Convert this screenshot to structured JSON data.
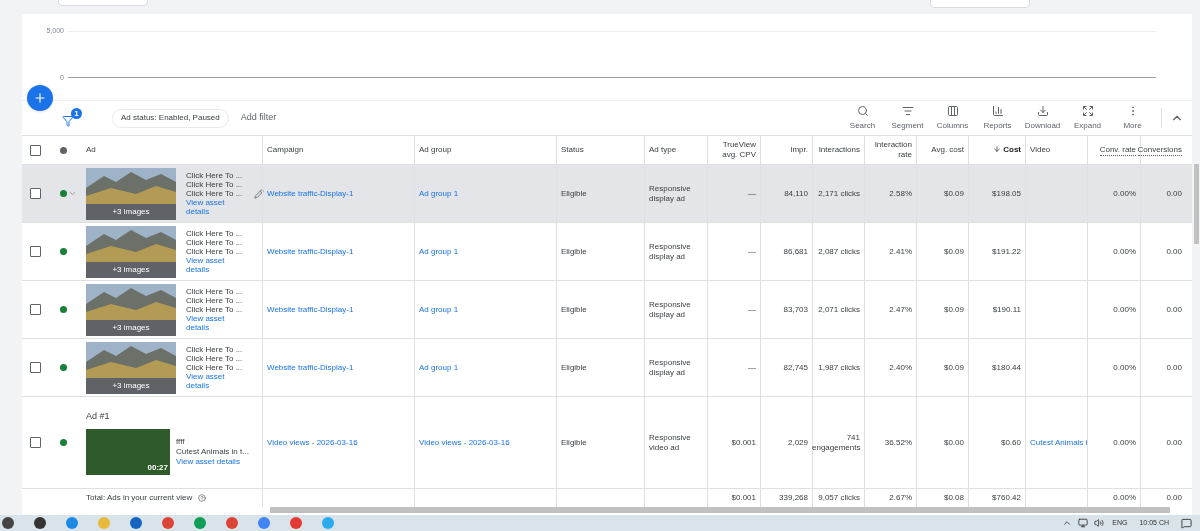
{
  "chart": {
    "yticks": [
      "5,000",
      "0"
    ]
  },
  "filter_bar": {
    "filter_count": "1",
    "chips": [
      "Ad status: Enabled, Paused"
    ],
    "add_filter": "Add filter"
  },
  "tools": [
    {
      "kind": "search",
      "label": "Search"
    },
    {
      "kind": "segment",
      "label": "Segment"
    },
    {
      "kind": "columns",
      "label": "Columns"
    },
    {
      "kind": "reports",
      "label": "Reports"
    },
    {
      "kind": "download",
      "label": "Download"
    },
    {
      "kind": "expand",
      "label": "Expand"
    },
    {
      "kind": "more",
      "label": "More"
    }
  ],
  "table": {
    "header_checked": false,
    "ad_column": "Ad",
    "columns": [
      {
        "label": "Campaign",
        "kind": "link",
        "sorted": false,
        "dotted": false
      },
      {
        "label": "Ad group",
        "kind": "link",
        "sorted": false,
        "dotted": false
      },
      {
        "label": "Status",
        "kind": "text",
        "sorted": false,
        "dotted": false
      },
      {
        "label": "Ad type",
        "kind": "text",
        "sorted": false,
        "dotted": false
      },
      {
        "label": "TrueView avg. CPV",
        "kind": "number",
        "sorted": false,
        "dotted": false
      },
      {
        "label": "Impr.",
        "kind": "number",
        "sorted": false,
        "dotted": false
      },
      {
        "label": "Interactions",
        "kind": "number",
        "sorted": false,
        "dotted": false
      },
      {
        "label": "Interaction rate",
        "kind": "number",
        "sorted": false,
        "dotted": false
      },
      {
        "label": "Avg. cost",
        "kind": "number",
        "sorted": false,
        "dotted": false
      },
      {
        "label": "Cost",
        "kind": "number",
        "sorted": true,
        "dotted": false
      },
      {
        "label": "Video",
        "kind": "link",
        "sorted": false,
        "dotted": false
      },
      {
        "label": "Conv. rate",
        "kind": "number",
        "sorted": false,
        "dotted": true
      },
      {
        "label": "Conversions",
        "kind": "number",
        "sorted": false,
        "dotted": true
      }
    ],
    "rows": [
      {
        "checked": false,
        "enabled": true,
        "hovered": true,
        "ad": {
          "kind": "image",
          "overlay": "+3 images",
          "headlines": [
            "Click Here To ...",
            "Click Here To ...",
            "Click Here To ..."
          ],
          "link": "View asset details"
        },
        "cells": [
          "Website traffic-Display-1",
          "Ad group 1",
          "Eligible",
          "Responsive display ad",
          "—",
          "84,110",
          "2,171 clicks",
          "2.58%",
          "$0.09",
          "$198.05",
          null,
          "0.00%",
          "0.00"
        ]
      },
      {
        "checked": false,
        "enabled": true,
        "hovered": false,
        "ad": {
          "kind": "image",
          "overlay": "+3 images",
          "headlines": [
            "Click Here To ...",
            "Click Here To ...",
            "Click Here To ..."
          ],
          "link": "View asset details"
        },
        "cells": [
          "Website traffic-Display-1",
          "Ad group 1",
          "Eligible",
          "Responsive display ad",
          "—",
          "86,681",
          "2,087 clicks",
          "2.41%",
          "$0.09",
          "$191.22",
          null,
          "0.00%",
          "0.00"
        ]
      },
      {
        "checked": false,
        "enabled": true,
        "hovered": false,
        "ad": {
          "kind": "image",
          "overlay": "+3 images",
          "headlines": [
            "Click Here To ...",
            "Click Here To ...",
            "Click Here To ..."
          ],
          "link": "View asset details"
        },
        "cells": [
          "Website traffic-Display-1",
          "Ad group 1",
          "Eligible",
          "Responsive display ad",
          "—",
          "83,703",
          "2,071 clicks",
          "2.47%",
          "$0.09",
          "$190.11",
          null,
          "0.00%",
          "0.00"
        ]
      },
      {
        "checked": false,
        "enabled": true,
        "hovered": false,
        "ad": {
          "kind": "image",
          "overlay": "+3 images",
          "headlines": [
            "Click Here To ...",
            "Click Here To ...",
            "Click Here To ..."
          ],
          "link": "View asset details"
        },
        "cells": [
          "Website traffic-Display-1",
          "Ad group 1",
          "Eligible",
          "Responsive display ad",
          "—",
          "82,745",
          "1,987 clicks",
          "2.40%",
          "$0.09",
          "$180.44",
          null,
          "0.00%",
          "0.00"
        ]
      },
      {
        "checked": false,
        "enabled": true,
        "hovered": false,
        "ad": {
          "kind": "video",
          "title": "Ad #1",
          "duration": "00:27",
          "headlines": [
            "ffff",
            "Cutest Animals in t..."
          ],
          "link": "View asset details"
        },
        "cells": [
          "Video views - 2026-03-16",
          "Video views - 2026-03-16",
          "Eligible",
          "Responsive video ad",
          "$0.001",
          "2,029",
          "741 engagements",
          "36.52%",
          "$0.00",
          "$0.60",
          "Cutest Animals i",
          "0.00%",
          "0.00"
        ]
      }
    ],
    "total": {
      "label": "Total: Ads in your current view",
      "cells": [
        null,
        null,
        null,
        null,
        "$0.001",
        "339,268",
        "9,057 clicks",
        "2.67%",
        "$0.08",
        "$760.42",
        null,
        "0.00%",
        "0.00"
      ]
    }
  },
  "taskbar": {
    "language": "ENG",
    "time": "10:05 CH"
  }
}
